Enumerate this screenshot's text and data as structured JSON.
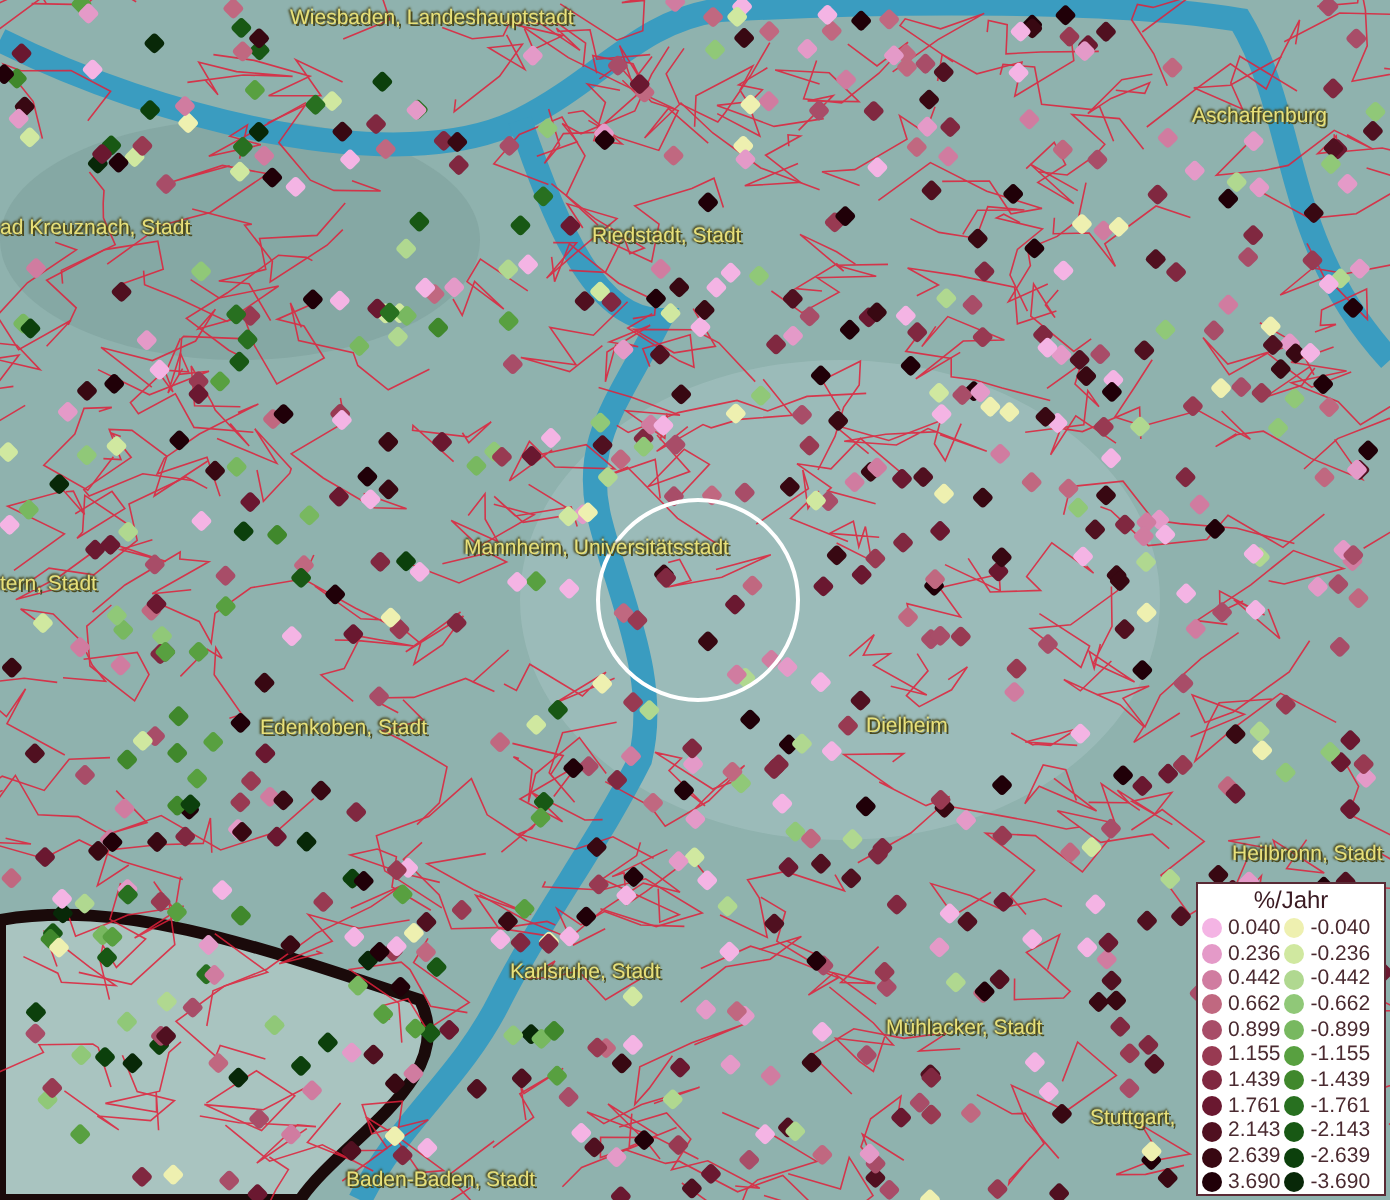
{
  "map": {
    "labels": [
      {
        "text": "Wiesbaden, Landeshauptstadt"
      },
      {
        "text": "Aschaffenburg"
      },
      {
        "text": "ad Kreuznach, Stadt"
      },
      {
        "text": "Riedstadt, Stadt"
      },
      {
        "text": "Mannheim, Universitätsstadt"
      },
      {
        "text": "tern, Stadt"
      },
      {
        "text": "Edenkoben, Stadt"
      },
      {
        "text": "Dielheim"
      },
      {
        "text": "Heilbronn, Stadt"
      },
      {
        "text": "Karlsruhe, Stadt"
      },
      {
        "text": "Mühlacker, Stadt"
      },
      {
        "text": "Stuttgart,"
      },
      {
        "text": "Baden-Baden, Stadt"
      }
    ]
  },
  "legend": {
    "title": "%/Jahr",
    "positive": [
      {
        "value": "0.040",
        "color": "#f4b4e4"
      },
      {
        "value": "0.236",
        "color": "#e49ac8"
      },
      {
        "value": "0.442",
        "color": "#d07ca0"
      },
      {
        "value": "0.662",
        "color": "#c06880"
      },
      {
        "value": "0.899",
        "color": "#a84d68"
      },
      {
        "value": "1.155",
        "color": "#983a52"
      },
      {
        "value": "1.439",
        "color": "#802840"
      },
      {
        "value": "1.761",
        "color": "#6a1830"
      },
      {
        "value": "2.143",
        "color": "#501020"
      },
      {
        "value": "2.639",
        "color": "#380812"
      },
      {
        "value": "3.690",
        "color": "#200008"
      }
    ],
    "negative": [
      {
        "value": "-0.040",
        "color": "#eef0b0"
      },
      {
        "value": "-0.236",
        "color": "#d0e8a0"
      },
      {
        "value": "-0.442",
        "color": "#b0d890"
      },
      {
        "value": "-0.662",
        "color": "#90c878"
      },
      {
        "value": "-0.899",
        "color": "#78b860"
      },
      {
        "value": "-1.155",
        "color": "#58a040"
      },
      {
        "value": "-1.439",
        "color": "#40882c"
      },
      {
        "value": "-1.761",
        "color": "#287020"
      },
      {
        "value": "-2.143",
        "color": "#185814"
      },
      {
        "value": "-2.639",
        "color": "#0c400c"
      },
      {
        "value": "-3.690",
        "color": "#082808"
      }
    ]
  }
}
